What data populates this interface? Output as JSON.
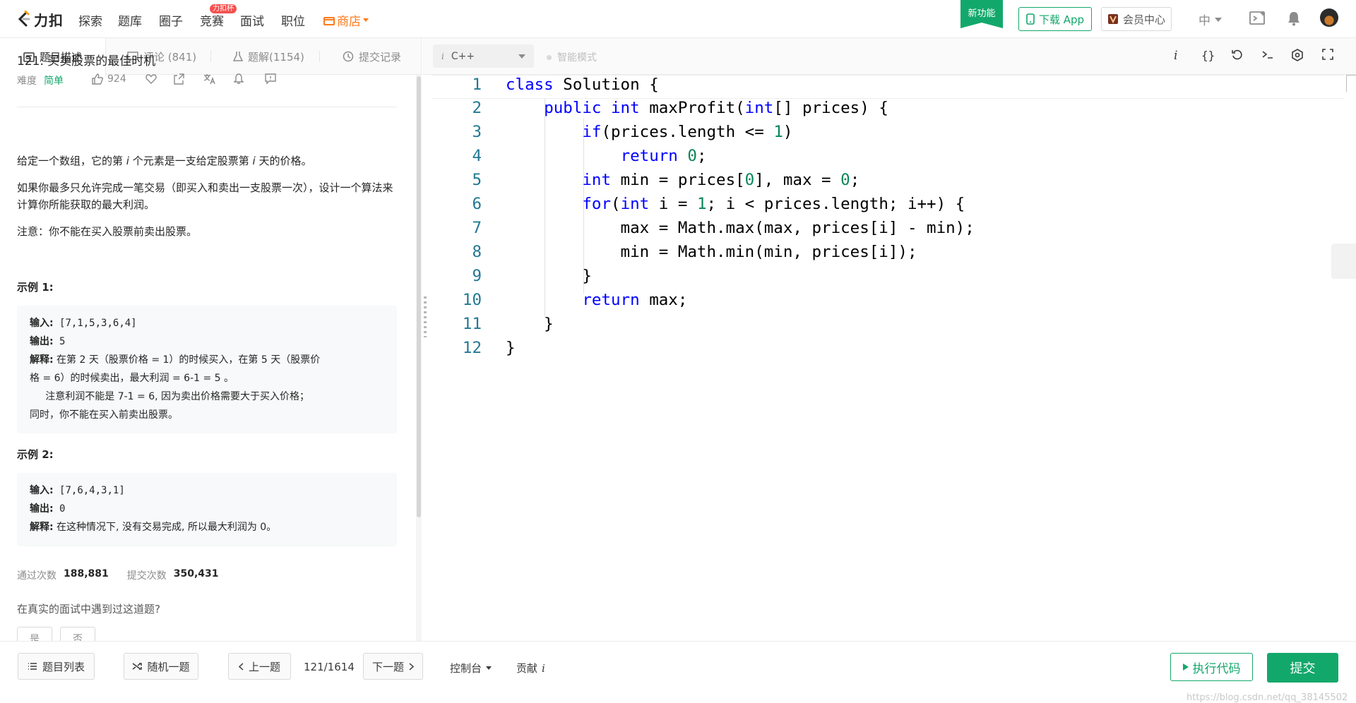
{
  "nav": {
    "brand": "力扣",
    "items": [
      "探索",
      "题库",
      "圈子",
      "竞赛",
      "面试",
      "职位"
    ],
    "contest_badge": "力扣杯",
    "store": "商店",
    "new_feature": "新功能",
    "download_app": "下载 App",
    "member_center": "会员中心",
    "language": "中"
  },
  "tabs": {
    "description": "题目描述",
    "comments": "评论 (841)",
    "solutions": "题解(1154)",
    "submissions": "提交记录"
  },
  "problem": {
    "title": "121. 买卖股票的最佳时机",
    "difficulty_label": "难度",
    "difficulty": "简单",
    "likes": "924",
    "para1_a": "给定一个数组，它的第 ",
    "para1_i": "i",
    "para1_b": " 个元素是一支给定股票第 ",
    "para1_i2": "i",
    "para1_c": " 天的价格。",
    "para2": "如果你最多只允许完成一笔交易（即买入和卖出一支股票一次），设计一个算法来计算你所能获取的最大利润。",
    "para3": "注意：你不能在买入股票前卖出股票。",
    "example1_title": "示例 1:",
    "example1": {
      "input_label": "输入:",
      "input": " [7,1,5,3,6,4]",
      "output_label": "输出:",
      "output": " 5",
      "explain_label": "解释:",
      "explain_l1": " 在第 2 天（股票价格 = 1）的时候买入，在第 5 天（股票价",
      "explain_l2": "格 = 6）的时候卖出，最大利润 = 6-1 = 5 。",
      "explain_l3": "     注意利润不能是 7-1 = 6, 因为卖出价格需要大于买入价格；",
      "explain_l4": "同时，你不能在买入前卖出股票。"
    },
    "example2_title": "示例 2:",
    "example2": {
      "input_label": "输入:",
      "input": " [7,6,4,3,1]",
      "output_label": "输出:",
      "output": " 0",
      "explain_label": "解释:",
      "explain": " 在这种情况下, 没有交易完成, 所以最大利润为 0。"
    },
    "accepted_label": "通过次数",
    "accepted": "188,881",
    "submitted_label": "提交次数",
    "submitted": "350,431",
    "interview_question": "在真实的面试中遇到过这道题?",
    "yes": "是",
    "no": "否"
  },
  "editor": {
    "language": "C++",
    "smart_mode": "智能模式",
    "line_numbers": [
      "1",
      "2",
      "3",
      "4",
      "5",
      "6",
      "7",
      "8",
      "9",
      "10",
      "11",
      "12"
    ]
  },
  "bottom": {
    "problem_list": "题目列表",
    "random": "随机一题",
    "prev": "上一题",
    "page": "121/1614",
    "next": "下一题",
    "console": "控制台",
    "contribute": "贡献",
    "run": "执行代码",
    "submit": "提交",
    "watermark": "https://blog.csdn.net/qq_38145502"
  },
  "colors": {
    "accent_green": "#13a86b",
    "store_orange": "#ff7a1a",
    "badge_red": "#f5504e",
    "keyword_blue": "#0000ff",
    "number_green": "#098658",
    "line_number": "#237893"
  }
}
